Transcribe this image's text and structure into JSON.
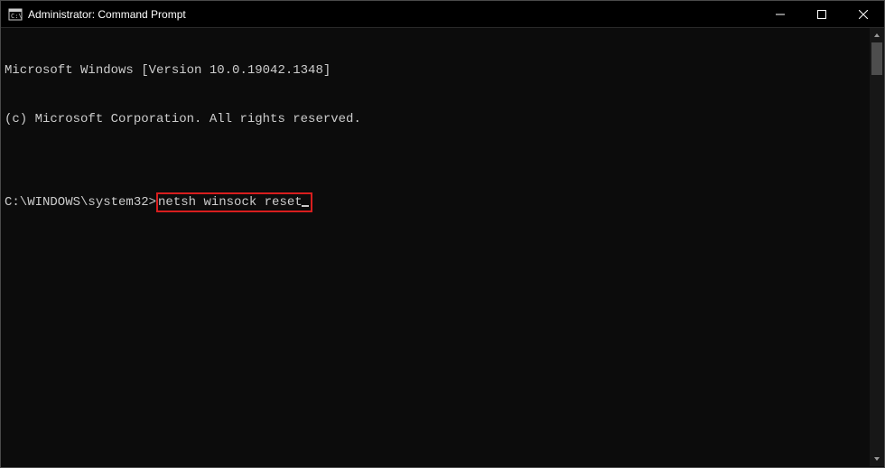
{
  "titlebar": {
    "title": "Administrator: Command Prompt"
  },
  "terminal": {
    "line1": "Microsoft Windows [Version 10.0.19042.1348]",
    "line2": "(c) Microsoft Corporation. All rights reserved.",
    "blank": "",
    "prompt": "C:\\WINDOWS\\system32>",
    "command": "netsh winsock reset"
  }
}
